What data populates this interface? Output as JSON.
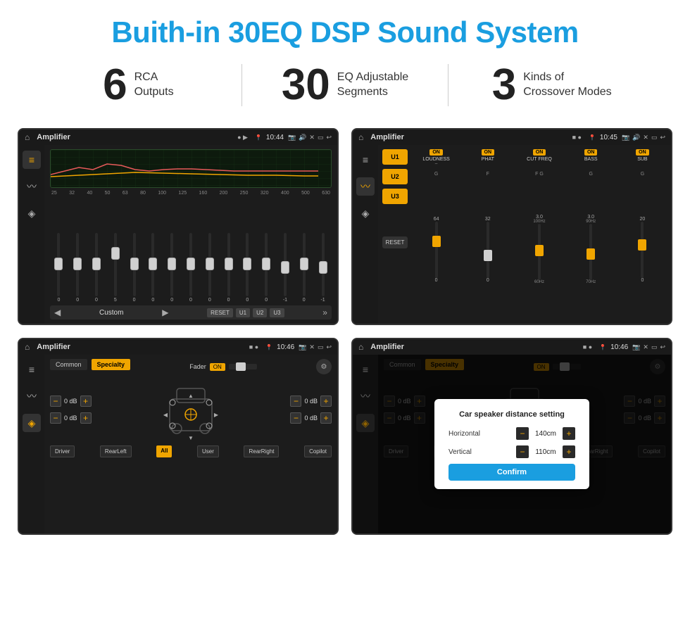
{
  "header": {
    "title": "Buith-in 30EQ DSP Sound System"
  },
  "stats": [
    {
      "number": "6",
      "text_line1": "RCA",
      "text_line2": "Outputs"
    },
    {
      "number": "30",
      "text_line1": "EQ Adjustable",
      "text_line2": "Segments"
    },
    {
      "number": "3",
      "text_line1": "Kinds of",
      "text_line2": "Crossover Modes"
    }
  ],
  "screen1": {
    "title": "Amplifier",
    "time": "10:44",
    "eq_labels": [
      "25",
      "32",
      "40",
      "50",
      "63",
      "80",
      "100",
      "125",
      "160",
      "200",
      "250",
      "320",
      "400",
      "500",
      "630"
    ],
    "eq_values": [
      "0",
      "0",
      "0",
      "5",
      "0",
      "0",
      "0",
      "0",
      "0",
      "0",
      "0",
      "0",
      "-1",
      "0",
      "-1"
    ],
    "nav": {
      "label": "Custom",
      "buttons": [
        "RESET",
        "U1",
        "U2",
        "U3"
      ]
    }
  },
  "screen2": {
    "title": "Amplifier",
    "time": "10:45",
    "channels": [
      "U1",
      "U2",
      "U3"
    ],
    "controls": [
      "LOUDNESS",
      "PHAT",
      "CUT FREQ",
      "BASS",
      "SUB"
    ],
    "reset_label": "RESET"
  },
  "screen3": {
    "title": "Amplifier",
    "time": "10:46",
    "tabs": [
      "Common",
      "Specialty"
    ],
    "fader_label": "Fader",
    "on_label": "ON",
    "db_values": [
      "0 dB",
      "0 dB",
      "0 dB",
      "0 dB"
    ],
    "bottom_buttons": [
      "Driver",
      "RearLeft",
      "All",
      "User",
      "RearRight",
      "Copilot"
    ]
  },
  "screen4": {
    "title": "Amplifier",
    "time": "10:46",
    "tabs": [
      "Common",
      "Specialty"
    ],
    "on_label": "ON",
    "db_values": [
      "0 dB",
      "0 dB"
    ],
    "dialog": {
      "title": "Car speaker distance setting",
      "horizontal_label": "Horizontal",
      "horizontal_value": "140cm",
      "vertical_label": "Vertical",
      "vertical_value": "110cm",
      "confirm_label": "Confirm"
    },
    "bottom_buttons": [
      "Driver",
      "RearLeft",
      "All",
      "User",
      "RearRight",
      "Copilot"
    ]
  }
}
